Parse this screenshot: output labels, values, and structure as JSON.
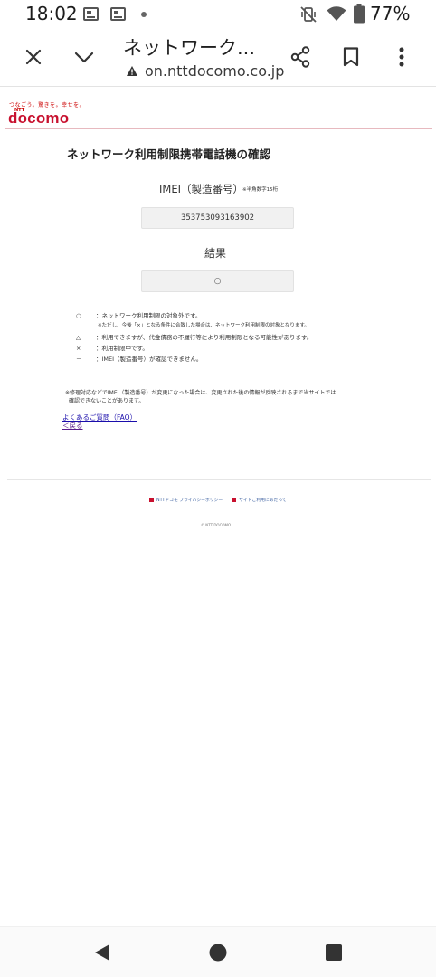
{
  "status_bar": {
    "time": "18:02",
    "battery_percent": "77%"
  },
  "browser": {
    "page_title": "ネットワーク...",
    "url": "on.nttdocomo.co.jp"
  },
  "brand": {
    "tagline": "つなごう。驚きを。幸せを。",
    "ntt": "NTT",
    "logo": "docomo",
    "color": "#c8102e"
  },
  "main": {
    "heading": "ネットワーク利用制限携帯電話機の確認",
    "imei_label": "IMEI（製造番号）",
    "imei_note": "※半角数字15桁",
    "imei_value": "353753093163902",
    "result_label": "結果",
    "result_value": "○",
    "legend": [
      {
        "symbol": "○",
        "text": "：ネットワーク利用制限の対象外です。"
      },
      {
        "symbol": "",
        "text": "※ただし、今後「×」となる条件に合致した場合は、ネットワーク利用制限の対象となります。"
      },
      {
        "symbol": "△",
        "text": "：利用できますが、代金債務の不履行等により利用制限となる可能性があります。"
      },
      {
        "symbol": "×",
        "text": "：利用制限中です。"
      },
      {
        "symbol": "－",
        "text": "：IMEI（製造番号）が確認できません。"
      }
    ],
    "notice_line1": "※修理対応などでIMEI（製造番号）が変更になった場合は、変更された後の情報が反映されるまで当サイトでは",
    "notice_line2": "確認できないことがあります。",
    "faq_link": "よくあるご質問（FAQ）",
    "back_link": "＜戻る"
  },
  "footer": {
    "privacy_link": "NTTドコモ プライバシーポリシー",
    "terms_link": "サイトご利用にあたって",
    "copyright": "© NTT DOCOMO"
  }
}
